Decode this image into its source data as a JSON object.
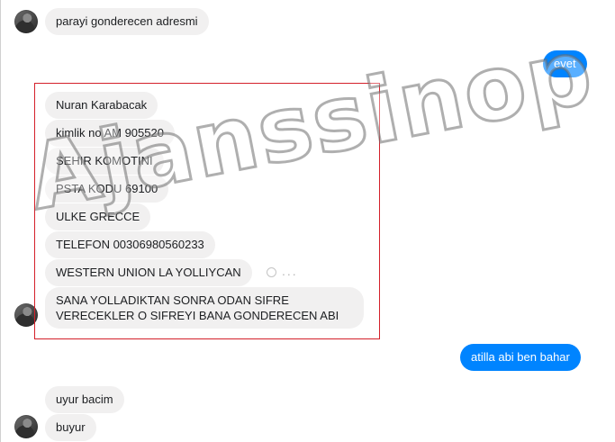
{
  "messages": [
    {
      "text": "parayi gonderecen adresmi",
      "from": "them"
    },
    {
      "text": "evet",
      "from": "me"
    },
    {
      "text": "Nuran Karabacak",
      "from": "them"
    },
    {
      "text": "kimlik no AM 905520",
      "from": "them"
    },
    {
      "text": "SEHIR  KOMOTINI",
      "from": "them"
    },
    {
      "text": "PSTA KODU 69100",
      "from": "them"
    },
    {
      "text": "ULKE GRECCE",
      "from": "them"
    },
    {
      "text": "TELEFON 00306980560233",
      "from": "them"
    },
    {
      "text": "WESTERN UNION LA YOLLIYCAN",
      "from": "them"
    },
    {
      "text": "SANA YOLLADIKTAN SONRA ODAN SIFRE\nVERECEKLER O SIFREYI BANA GONDERECEN ABI",
      "from": "them"
    },
    {
      "text": "atilla abi ben bahar",
      "from": "me"
    },
    {
      "text": "uyur bacim",
      "from": "them"
    },
    {
      "text": "buyur",
      "from": "them"
    }
  ],
  "message_actions": {
    "icons": [
      "emoji-reaction-icon",
      "more-options-icon"
    ],
    "more_glyph": "..."
  },
  "watermark": {
    "text": "Ajanssinop"
  },
  "colors": {
    "incoming_bubble": "#f1f0f0",
    "outgoing_bubble": "#0084ff",
    "highlight_border": "#d4202a"
  }
}
